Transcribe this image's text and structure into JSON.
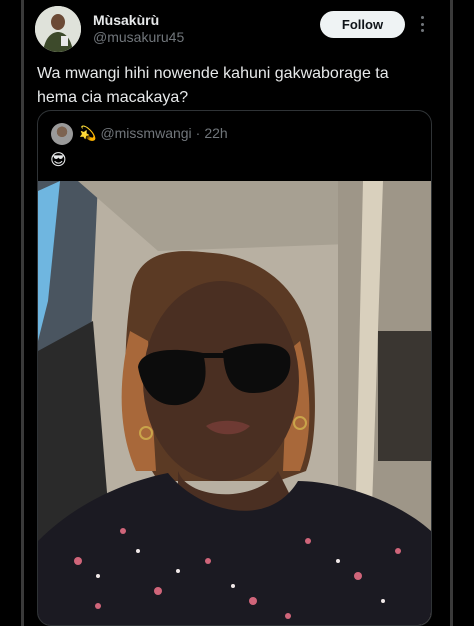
{
  "author": {
    "display_name": "Mùsakùrù",
    "handle": "@musakuru45",
    "avatar_icon": "profile-avatar"
  },
  "follow_label": "Follow",
  "tweet_text": "Wa mwangi hihi nowende kahuni gakwaborage ta hema cia macakaya?",
  "quote": {
    "badge_icon": "💫",
    "handle": "@missmwangi",
    "separator": "·",
    "time": "22h",
    "text": "😎"
  },
  "colors": {
    "background": "#000000",
    "text": "#e7e9ea",
    "secondary": "#71767b",
    "follow_bg": "#eff3f4",
    "border": "#2f3336"
  }
}
